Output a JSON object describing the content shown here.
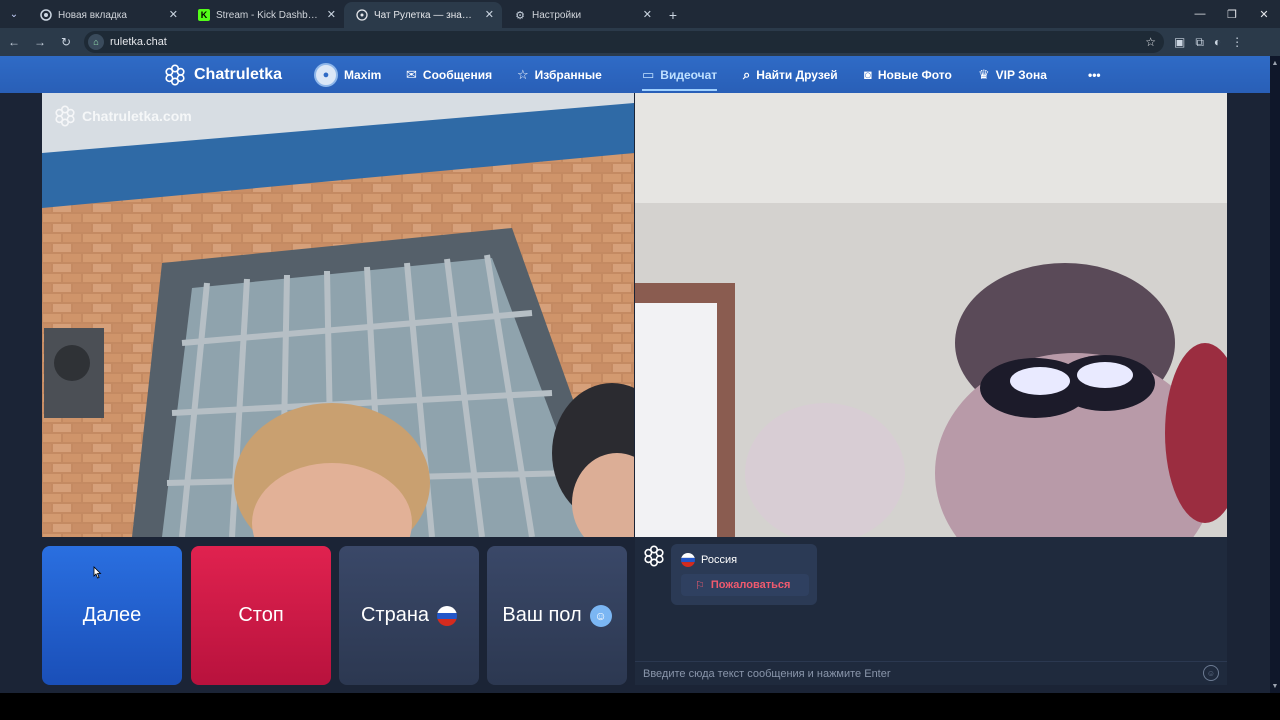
{
  "browser": {
    "tabs": [
      {
        "title": "Новая вкладка",
        "icon": "chrome-icon"
      },
      {
        "title": "Stream - Kick Dashboard",
        "icon": "kick-icon"
      },
      {
        "title": "Чат Рулетка — знакомства",
        "icon": "chatruletka-icon",
        "active": true
      },
      {
        "title": "Настройки",
        "icon": "gear-icon"
      }
    ],
    "url": "ruletka.chat"
  },
  "site": {
    "logo": "Chatruletka",
    "nav": {
      "profile": "Maxim",
      "messages": "Сообщения",
      "favorites": "Избранные",
      "videochat": "Видеочат",
      "find_friends": "Найти Друзей",
      "new_photos": "Новые Фото",
      "vip": "VIP Зона",
      "more": "•••"
    },
    "watermark": "Chatruletka.com"
  },
  "controls": {
    "next": "Далее",
    "stop": "Стоп",
    "country": "Страна",
    "gender": "Ваш пол"
  },
  "chat": {
    "partner_country": "Россия",
    "report": "Пожаловаться",
    "input_placeholder": "Введите сюда текст сообщения и нажмите Enter"
  },
  "colors": {
    "nav_bg": "#2f6bc6",
    "next_btn": "#2a6fe0",
    "stop_btn": "#e0224f",
    "report_text": "#f05a6e"
  }
}
